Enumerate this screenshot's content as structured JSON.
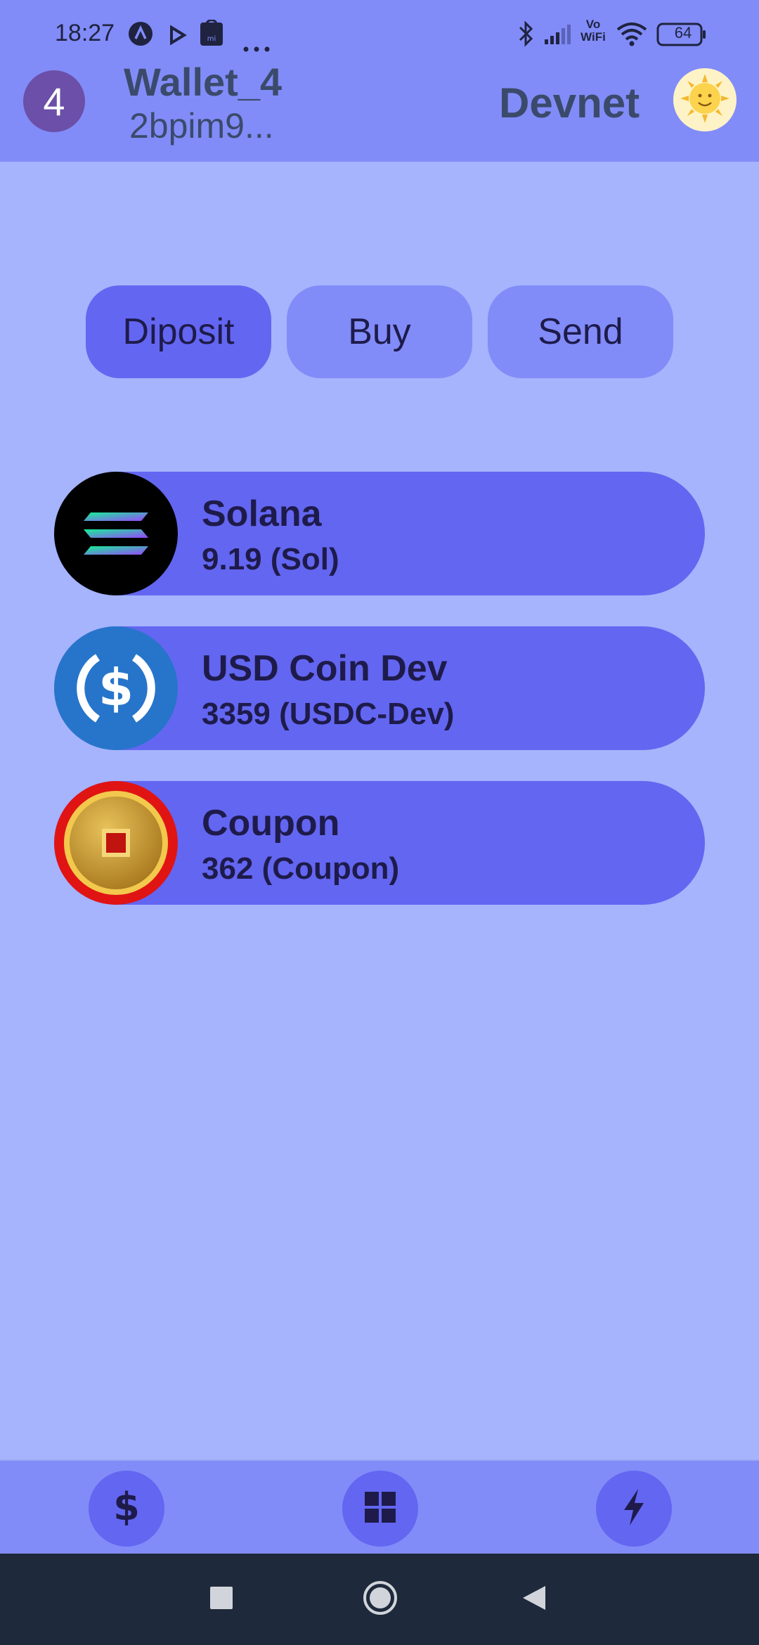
{
  "status_bar": {
    "time": "18:27",
    "battery": "64",
    "icons": [
      "notification-a-icon",
      "play-icon",
      "mi-store-icon",
      "more-dots-icon",
      "bluetooth-icon",
      "signal-icon",
      "vowifi-icon",
      "wifi-icon",
      "battery-icon"
    ],
    "vowifi_top": "Vo",
    "vowifi_bottom": "WiFi"
  },
  "header": {
    "avatar_number": "4",
    "wallet_name": "Wallet_4",
    "wallet_address": "2bpim9...",
    "network": "Devnet",
    "theme_icon": "sun-face-icon"
  },
  "actions": [
    {
      "label": "Diposit"
    },
    {
      "label": "Buy"
    },
    {
      "label": "Send"
    }
  ],
  "tokens": [
    {
      "name": "Solana",
      "balance": "9.19 (Sol)",
      "icon": "solana-icon"
    },
    {
      "name": "USD Coin Dev",
      "balance": "3359 (USDC-Dev)",
      "icon": "usdc-icon"
    },
    {
      "name": "Coupon",
      "balance": "362 (Coupon)",
      "icon": "coupon-coin-icon"
    }
  ],
  "tabs": [
    {
      "icon": "dollar-icon"
    },
    {
      "icon": "grid-icon"
    },
    {
      "icon": "lightning-icon"
    }
  ],
  "colors": {
    "background": "#a5b4fc",
    "header": "#818cf8",
    "accent": "#6366f1",
    "nav": "#1e293b"
  }
}
